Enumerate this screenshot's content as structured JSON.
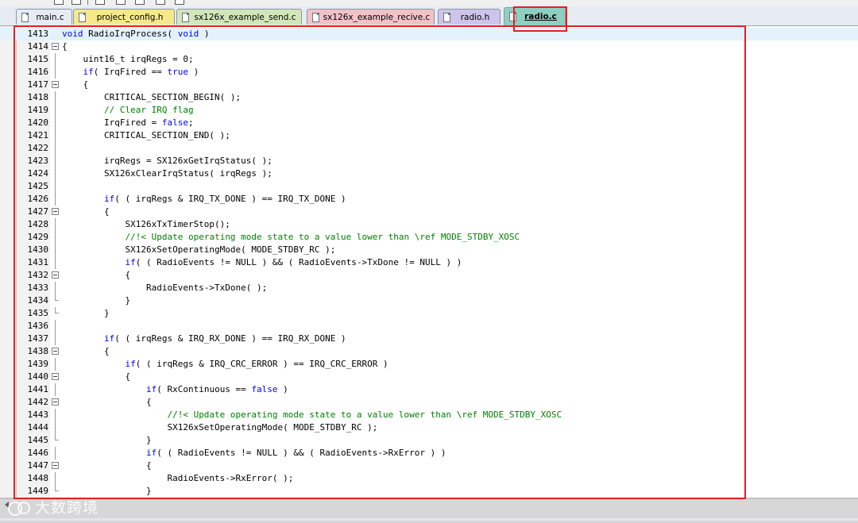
{
  "tabs": [
    {
      "label": "main.c",
      "color": "#e6ecf2",
      "active": false
    },
    {
      "label": "project_config.h",
      "color": "#f5e98b",
      "active": false
    },
    {
      "label": "sx126x_example_send.c",
      "color": "#d3e6b9",
      "active": false
    },
    {
      "label": "sx126x_example_recive.c",
      "color": "#f1c2c7",
      "active": false
    },
    {
      "label": "radio.h",
      "color": "#cdc4eb",
      "active": false
    },
    {
      "label": "radio.c",
      "color": "#8fcfc2",
      "active": true
    }
  ],
  "editor": {
    "current_line": "1413",
    "lines": [
      {
        "num": "1413",
        "fold": "none",
        "segments": [
          {
            "t": "void",
            "c": "kw"
          },
          {
            "t": " RadioIrqProcess( ",
            "c": ""
          },
          {
            "t": "void",
            "c": "kw"
          },
          {
            "t": " )",
            "c": ""
          }
        ]
      },
      {
        "num": "1414",
        "fold": "open",
        "segments": [
          {
            "t": "{",
            "c": ""
          }
        ]
      },
      {
        "num": "1415",
        "fold": "line",
        "segments": [
          {
            "t": "    uint16_t irqRegs = 0;",
            "c": ""
          }
        ]
      },
      {
        "num": "1416",
        "fold": "line",
        "segments": [
          {
            "t": "    ",
            "c": ""
          },
          {
            "t": "if",
            "c": "kw"
          },
          {
            "t": "( IrqFired == ",
            "c": ""
          },
          {
            "t": "true",
            "c": "kw"
          },
          {
            "t": " )",
            "c": ""
          }
        ]
      },
      {
        "num": "1417",
        "fold": "open",
        "segments": [
          {
            "t": "    {",
            "c": ""
          }
        ]
      },
      {
        "num": "1418",
        "fold": "line",
        "segments": [
          {
            "t": "        CRITICAL_SECTION_BEGIN( );",
            "c": ""
          }
        ]
      },
      {
        "num": "1419",
        "fold": "line",
        "segments": [
          {
            "t": "        ",
            "c": ""
          },
          {
            "t": "// Clear IRQ flag",
            "c": "cm"
          }
        ]
      },
      {
        "num": "1420",
        "fold": "line",
        "segments": [
          {
            "t": "        IrqFired = ",
            "c": ""
          },
          {
            "t": "false",
            "c": "kw"
          },
          {
            "t": ";",
            "c": ""
          }
        ]
      },
      {
        "num": "1421",
        "fold": "line",
        "segments": [
          {
            "t": "        CRITICAL_SECTION_END( );",
            "c": ""
          }
        ]
      },
      {
        "num": "1422",
        "fold": "line",
        "segments": [
          {
            "t": "",
            "c": ""
          }
        ]
      },
      {
        "num": "1423",
        "fold": "line",
        "segments": [
          {
            "t": "        irqRegs = SX126xGetIrqStatus( );",
            "c": ""
          }
        ]
      },
      {
        "num": "1424",
        "fold": "line",
        "segments": [
          {
            "t": "        SX126xClearIrqStatus( irqRegs );",
            "c": ""
          }
        ]
      },
      {
        "num": "1425",
        "fold": "line",
        "segments": [
          {
            "t": "",
            "c": ""
          }
        ]
      },
      {
        "num": "1426",
        "fold": "line",
        "segments": [
          {
            "t": "        ",
            "c": ""
          },
          {
            "t": "if",
            "c": "kw"
          },
          {
            "t": "( ( irqRegs & IRQ_TX_DONE ) == IRQ_TX_DONE )",
            "c": ""
          }
        ]
      },
      {
        "num": "1427",
        "fold": "open",
        "segments": [
          {
            "t": "        {",
            "c": ""
          }
        ]
      },
      {
        "num": "1428",
        "fold": "line",
        "segments": [
          {
            "t": "            SX126xTxTimerStop();",
            "c": ""
          }
        ]
      },
      {
        "num": "1429",
        "fold": "line",
        "segments": [
          {
            "t": "            ",
            "c": ""
          },
          {
            "t": "//!< Update operating mode state to a value lower than \\ref MODE_STDBY_XOSC",
            "c": "cm"
          }
        ]
      },
      {
        "num": "1430",
        "fold": "line",
        "segments": [
          {
            "t": "            SX126xSetOperatingMode( MODE_STDBY_RC );",
            "c": ""
          }
        ]
      },
      {
        "num": "1431",
        "fold": "line",
        "segments": [
          {
            "t": "            ",
            "c": ""
          },
          {
            "t": "if",
            "c": "kw"
          },
          {
            "t": "( ( RadioEvents != NULL ) && ( RadioEvents->TxDone != NULL ) )",
            "c": ""
          }
        ]
      },
      {
        "num": "1432",
        "fold": "open",
        "segments": [
          {
            "t": "            {",
            "c": ""
          }
        ]
      },
      {
        "num": "1433",
        "fold": "line",
        "segments": [
          {
            "t": "                RadioEvents->TxDone( );",
            "c": ""
          }
        ]
      },
      {
        "num": "1434",
        "fold": "end",
        "segments": [
          {
            "t": "            }",
            "c": ""
          }
        ]
      },
      {
        "num": "1435",
        "fold": "end",
        "segments": [
          {
            "t": "        }",
            "c": ""
          }
        ]
      },
      {
        "num": "1436",
        "fold": "line",
        "segments": [
          {
            "t": "",
            "c": ""
          }
        ]
      },
      {
        "num": "1437",
        "fold": "line",
        "segments": [
          {
            "t": "        ",
            "c": ""
          },
          {
            "t": "if",
            "c": "kw"
          },
          {
            "t": "( ( irqRegs & IRQ_RX_DONE ) == IRQ_RX_DONE )",
            "c": ""
          }
        ]
      },
      {
        "num": "1438",
        "fold": "open",
        "segments": [
          {
            "t": "        {",
            "c": ""
          }
        ]
      },
      {
        "num": "1439",
        "fold": "line",
        "segments": [
          {
            "t": "            ",
            "c": ""
          },
          {
            "t": "if",
            "c": "kw"
          },
          {
            "t": "( ( irqRegs & IRQ_CRC_ERROR ) == IRQ_CRC_ERROR )",
            "c": ""
          }
        ]
      },
      {
        "num": "1440",
        "fold": "open",
        "segments": [
          {
            "t": "            {",
            "c": ""
          }
        ]
      },
      {
        "num": "1441",
        "fold": "line",
        "segments": [
          {
            "t": "                ",
            "c": ""
          },
          {
            "t": "if",
            "c": "kw"
          },
          {
            "t": "( RxContinuous == ",
            "c": ""
          },
          {
            "t": "false",
            "c": "kw"
          },
          {
            "t": " )",
            "c": ""
          }
        ]
      },
      {
        "num": "1442",
        "fold": "open",
        "segments": [
          {
            "t": "                {",
            "c": ""
          }
        ]
      },
      {
        "num": "1443",
        "fold": "line",
        "segments": [
          {
            "t": "                    ",
            "c": ""
          },
          {
            "t": "//!< Update operating mode state to a value lower than \\ref MODE_STDBY_XOSC",
            "c": "cm"
          }
        ]
      },
      {
        "num": "1444",
        "fold": "line",
        "segments": [
          {
            "t": "                    SX126xSetOperatingMode( MODE_STDBY_RC );",
            "c": ""
          }
        ]
      },
      {
        "num": "1445",
        "fold": "end",
        "segments": [
          {
            "t": "                }",
            "c": ""
          }
        ]
      },
      {
        "num": "1446",
        "fold": "line",
        "segments": [
          {
            "t": "                ",
            "c": ""
          },
          {
            "t": "if",
            "c": "kw"
          },
          {
            "t": "( ( RadioEvents != NULL ) && ( RadioEvents->RxError ) )",
            "c": ""
          }
        ]
      },
      {
        "num": "1447",
        "fold": "open",
        "segments": [
          {
            "t": "                {",
            "c": ""
          }
        ]
      },
      {
        "num": "1448",
        "fold": "line",
        "segments": [
          {
            "t": "                    RadioEvents->RxError( );",
            "c": ""
          }
        ]
      },
      {
        "num": "1449",
        "fold": "end",
        "segments": [
          {
            "t": "                }",
            "c": ""
          }
        ]
      }
    ]
  },
  "annotation_color": "#e02025",
  "watermark": {
    "text": "大数跨境",
    "logo": "double-circle-logo"
  }
}
